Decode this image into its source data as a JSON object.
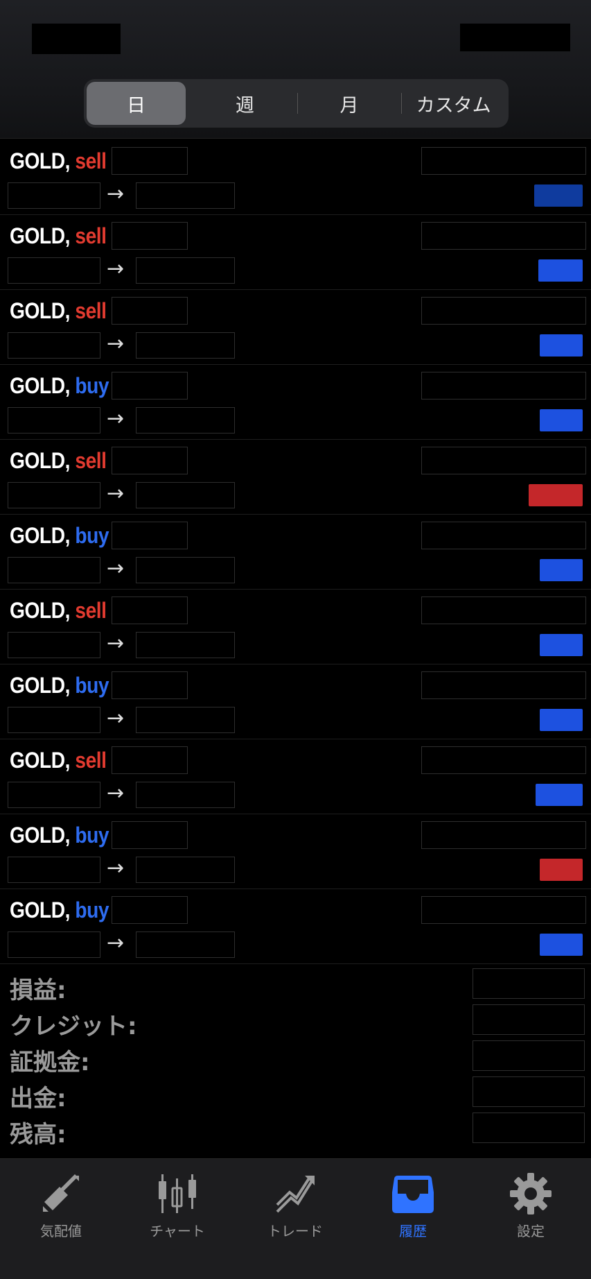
{
  "tabs_period": [
    "日",
    "週",
    "月",
    "カスタム"
  ],
  "active_period": "日",
  "trades": [
    {
      "symbol": "GOLD,",
      "side": "sell",
      "result_color": "#0f3b9e"
    },
    {
      "symbol": "GOLD,",
      "side": "sell",
      "result_color": "#1d51e0"
    },
    {
      "symbol": "GOLD,",
      "side": "sell",
      "result_color": "#1d51e0"
    },
    {
      "symbol": "GOLD,",
      "side": "buy",
      "result_color": "#1d51e0"
    },
    {
      "symbol": "GOLD,",
      "side": "sell",
      "result_color": "#c4272a"
    },
    {
      "symbol": "GOLD,",
      "side": "buy",
      "result_color": "#1d51e0"
    },
    {
      "symbol": "GOLD,",
      "side": "sell",
      "result_color": "#1d51e0"
    },
    {
      "symbol": "GOLD,",
      "side": "buy",
      "result_color": "#1d51e0"
    },
    {
      "symbol": "GOLD,",
      "side": "sell",
      "result_color": "#1d51e0"
    },
    {
      "symbol": "GOLD,",
      "side": "buy",
      "result_color": "#c4272a"
    },
    {
      "symbol": "GOLD,",
      "side": "buy",
      "result_color": "#1d51e0"
    }
  ],
  "arrow": "→",
  "summary": {
    "profit_label": "損益:",
    "credit_label": "クレジット:",
    "margin_label": "証拠金:",
    "withdrawal_label": "出金:",
    "balance_label": "残高:"
  },
  "tabbar": {
    "quotes": "気配値",
    "chart": "チャート",
    "trade": "トレード",
    "history": "履歴",
    "settings": "設定"
  },
  "colors": {
    "sell": "#e23b30",
    "buy": "#2e6cf0",
    "active_tab": "#2f73ff"
  }
}
